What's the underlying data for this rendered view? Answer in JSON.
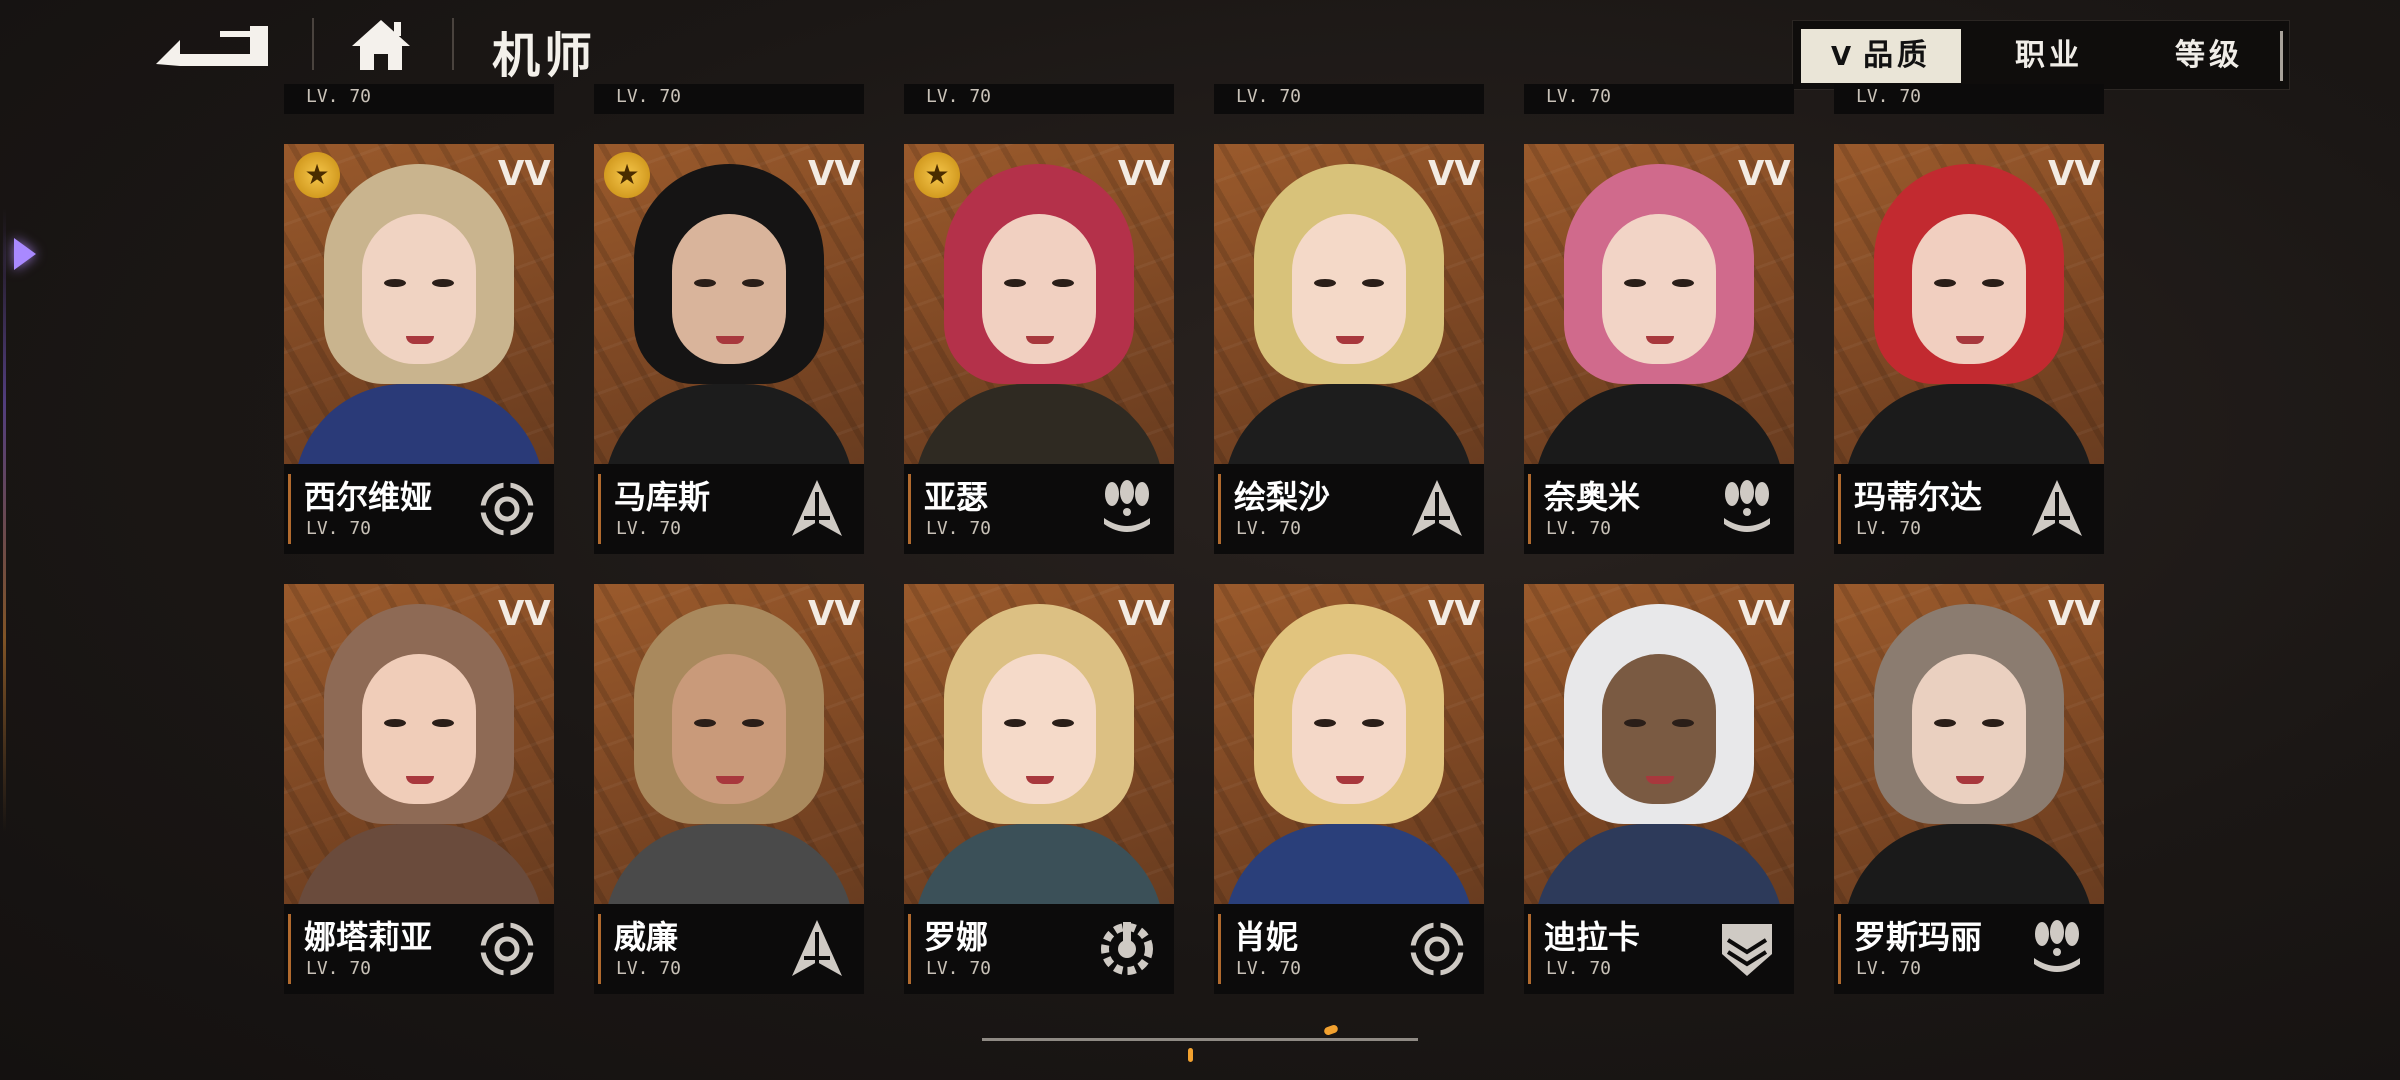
{
  "header": {
    "title": "机师"
  },
  "sort": {
    "tabs": [
      {
        "label": "品质",
        "active": true,
        "chevron": "V"
      },
      {
        "label": "职业",
        "active": false
      },
      {
        "label": "等级",
        "active": false
      }
    ]
  },
  "partial_row": [
    {
      "level": "LV. 70"
    },
    {
      "level": "LV. 70"
    },
    {
      "level": "LV. 70"
    },
    {
      "level": "LV. 70"
    },
    {
      "level": "LV. 70"
    },
    {
      "level": "LV. 70"
    }
  ],
  "pilots": [
    {
      "name": "西尔维娅",
      "level": "LV. 70",
      "star_badge": true,
      "class_icon": "target-icon",
      "hair": "#c9b48e",
      "skin": "#f0d3c2",
      "outfit": "#2a3a78"
    },
    {
      "name": "马库斯",
      "level": "LV. 70",
      "star_badge": true,
      "class_icon": "spear-icon",
      "hair": "#151414",
      "skin": "#d9b49b",
      "outfit": "#1c1c1c"
    },
    {
      "name": "亚瑟",
      "level": "LV. 70",
      "star_badge": true,
      "class_icon": "missile-icon",
      "hair": "#b4314a",
      "skin": "#f1d0c1",
      "outfit": "#2f2a22"
    },
    {
      "name": "绘梨沙",
      "level": "LV. 70",
      "star_badge": false,
      "class_icon": "spear-icon",
      "hair": "#d8c27a",
      "skin": "#f4d9c8",
      "outfit": "#1d1d1d"
    },
    {
      "name": "奈奥米",
      "level": "LV. 70",
      "star_badge": false,
      "class_icon": "missile-icon",
      "hair": "#d06a8c",
      "skin": "#f2d4c6",
      "outfit": "#1a1a1a"
    },
    {
      "name": "玛蒂尔达",
      "level": "LV. 70",
      "star_badge": false,
      "class_icon": "spear-icon",
      "hair": "#c22a30",
      "skin": "#f1cfc0",
      "outfit": "#1b1b1b"
    },
    {
      "name": "娜塔莉亚",
      "level": "LV. 70",
      "star_badge": false,
      "class_icon": "target-icon",
      "hair": "#8e6a55",
      "skin": "#f0cdb9",
      "outfit": "#6a4b3c"
    },
    {
      "name": "威廉",
      "level": "LV. 70",
      "star_badge": false,
      "class_icon": "spear-icon",
      "hair": "#a9895d",
      "skin": "#c99a7a",
      "outfit": "#4a4a4a"
    },
    {
      "name": "罗娜",
      "level": "LV. 70",
      "star_badge": false,
      "class_icon": "wrench-gear-icon",
      "hair": "#dcc083",
      "skin": "#f5dac9",
      "outfit": "#3b5058"
    },
    {
      "name": "肖妮",
      "level": "LV. 70",
      "star_badge": false,
      "class_icon": "target-icon",
      "hair": "#e1c47e",
      "skin": "#f4d8c8",
      "outfit": "#2a3f7a"
    },
    {
      "name": "迪拉卡",
      "level": "LV. 70",
      "star_badge": false,
      "class_icon": "shield-icon",
      "hair": "#e8e8ea",
      "skin": "#7a5a42",
      "outfit": "#2d3a5a"
    },
    {
      "name": "罗斯玛丽",
      "level": "LV. 70",
      "star_badge": false,
      "class_icon": "missile-icon",
      "hair": "#8b7c70",
      "skin": "#ead0c0",
      "outfit": "#1a1a1a"
    }
  ]
}
